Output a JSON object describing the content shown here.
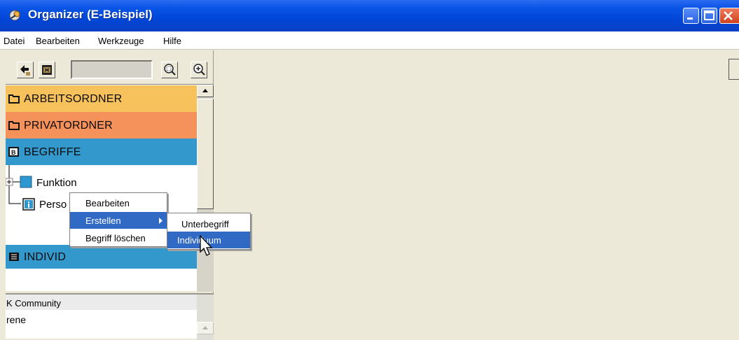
{
  "window": {
    "title": "Organizer (E-Beispiel)"
  },
  "menubar": {
    "items": [
      "Datei",
      "Bearbeiten",
      "Werkzeuge",
      "Hilfe"
    ]
  },
  "toolbar": {
    "search_value": ""
  },
  "navigator": {
    "folders": [
      {
        "label": "ARBEITSORDNER",
        "color": "#f7c15c"
      },
      {
        "label": "PRIVATORDNER",
        "color": "#f5915a"
      },
      {
        "label": "BEGRIFFE",
        "color": "#3399cc"
      },
      {
        "label": "INDIVID",
        "color": "#3399cc"
      }
    ],
    "tree": [
      {
        "label": "Funktion"
      },
      {
        "label": "Perso"
      }
    ]
  },
  "lower_pane": {
    "header": "K Community",
    "value": "rene"
  },
  "context_menu": {
    "items": [
      "Bearbeiten",
      "Erstellen",
      "Begriff löschen"
    ]
  },
  "submenu": {
    "items": [
      "Unterbegriff",
      "Individuum"
    ]
  },
  "colors": {
    "titlebar": "#0046d8",
    "highlight": "#316ac5",
    "begriffe": "#3399cc"
  }
}
